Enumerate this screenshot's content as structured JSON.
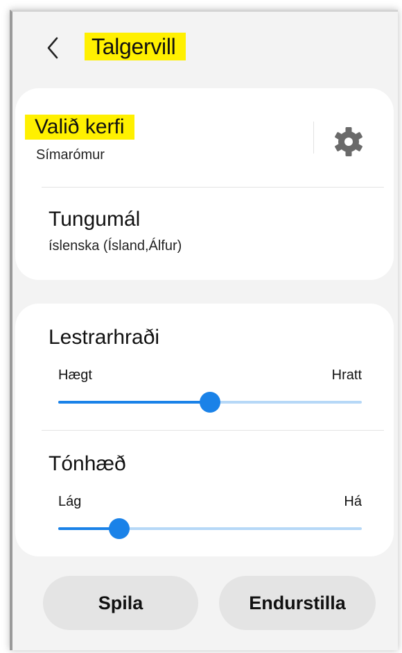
{
  "header": {
    "back_icon": "chevron-left-icon",
    "title": "Talgervill",
    "title_highlight_color": "#fff000"
  },
  "engine": {
    "title": "Valið kerfi",
    "value": "Símarómur",
    "settings_icon": "gear-icon"
  },
  "language": {
    "title": "Tungumál",
    "value": "íslenska (Ísland,Álfur)"
  },
  "speech_rate": {
    "title": "Lestrarhraði",
    "min_label": "Hægt",
    "max_label": "Hratt",
    "value": 0.5
  },
  "pitch": {
    "title": "Tónhæð",
    "min_label": "Lág",
    "max_label": "Há",
    "value": 0.2
  },
  "buttons": {
    "play": "Spila",
    "reset": "Endurstilla"
  },
  "colors": {
    "accent": "#1a82e8",
    "track_inactive": "#b6d8f7",
    "background": "#f3f3f3",
    "card": "#ffffff",
    "button_bg": "#e4e4e4"
  }
}
